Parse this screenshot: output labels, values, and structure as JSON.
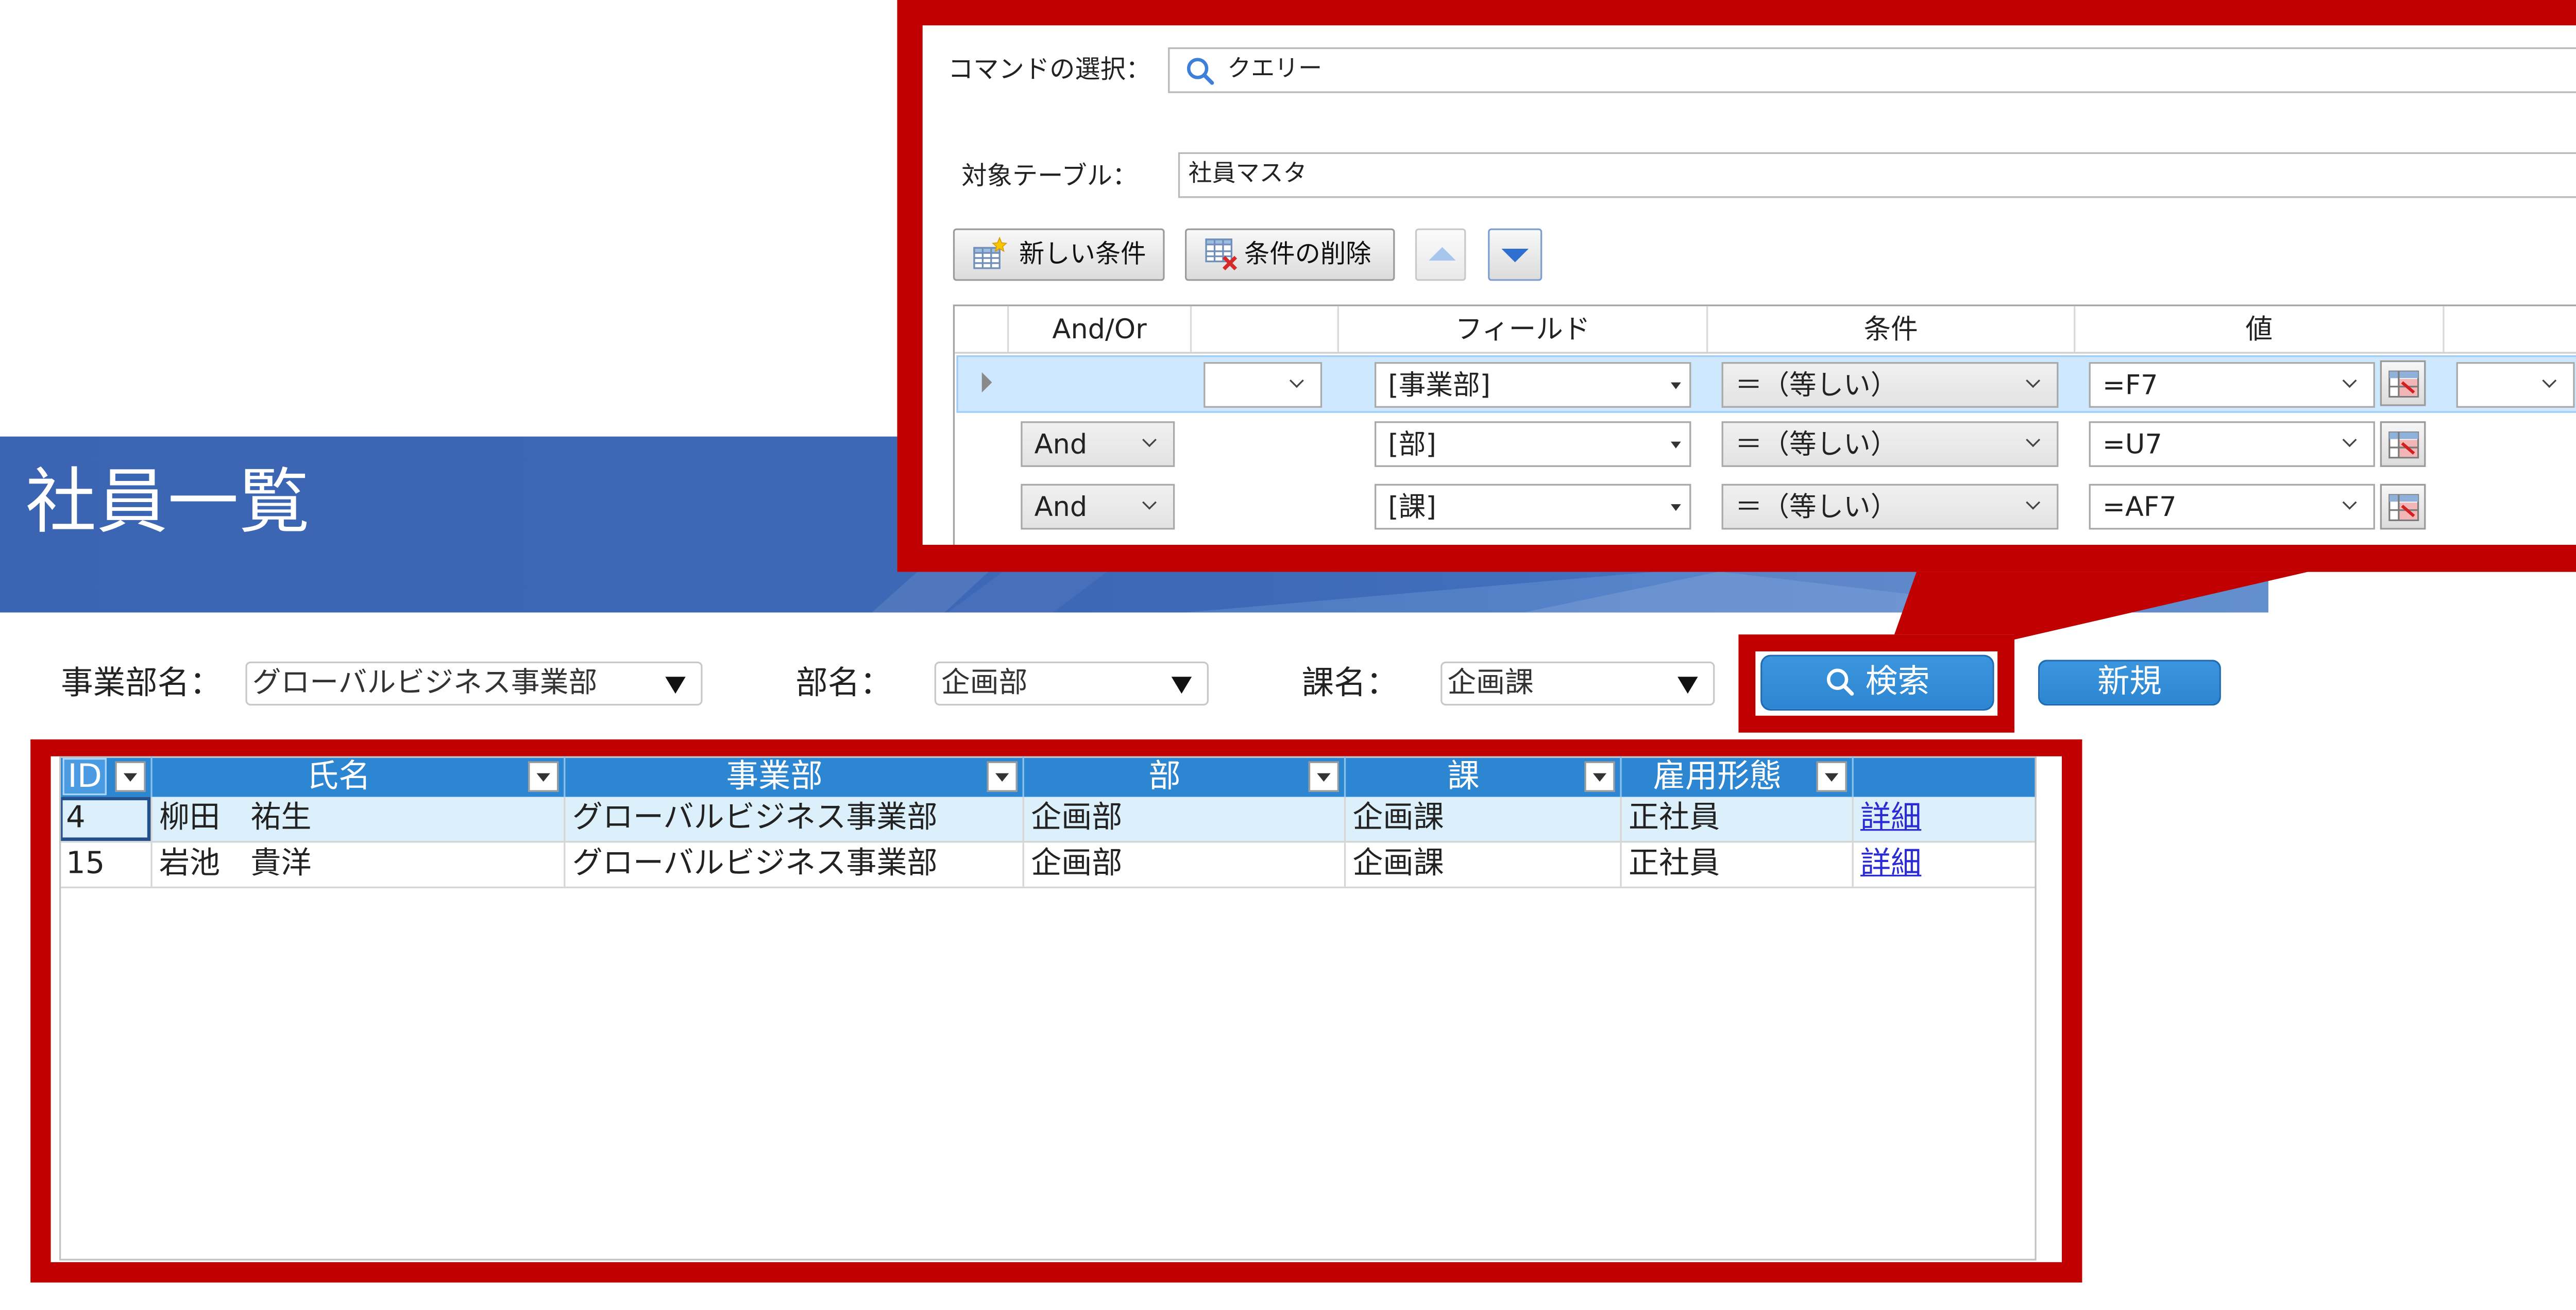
{
  "page": {
    "title": "社員一覧"
  },
  "colors": {
    "banner_blue": "#3b65b2",
    "accent_blue": "#2d86d1",
    "highlight_red": "#c00000",
    "selected_row": "#dcf0fb",
    "link_blue": "#2b2bd6"
  },
  "icons": {
    "search": "magnifier-icon",
    "dropdown": "triangle-down",
    "combo": "chevron-down",
    "new_condition": "table-star-icon",
    "delete_condition": "table-x-icon",
    "move_up": "triangle-up",
    "move_down": "triangle-down",
    "value_picker": "cell-picker-icon"
  },
  "filters": {
    "division": {
      "label": "事業部名：",
      "value": "グローバルビジネス事業部"
    },
    "department": {
      "label": "部名：",
      "value": "企画部"
    },
    "section": {
      "label": "課名：",
      "value": "企画課"
    }
  },
  "buttons": {
    "search": "検索",
    "new": "新規"
  },
  "table": {
    "columns": [
      "ID",
      "氏名",
      "事業部",
      "部",
      "課",
      "雇用形態"
    ],
    "rows": [
      {
        "id": "4",
        "name": "柳田　祐生",
        "division": "グローバルビジネス事業部",
        "department": "企画部",
        "section": "企画課",
        "employment": "正社員",
        "detail": "詳細"
      },
      {
        "id": "15",
        "name": "岩池　貴洋",
        "division": "グローバルビジネス事業部",
        "department": "企画部",
        "section": "企画課",
        "employment": "正社員",
        "detail": "詳細"
      }
    ]
  },
  "query_panel": {
    "command": {
      "label": "コマンドの選択：",
      "value": "クエリー"
    },
    "target_table": {
      "label": "対象テーブル：",
      "value": "社員マスタ"
    },
    "toolbar": {
      "new_condition": "新しい条件",
      "delete_condition": "条件の削除"
    },
    "grid_headers": {
      "and_or": "And/Or",
      "field": "フィールド",
      "condition": "条件",
      "value": "値"
    },
    "conditions": [
      {
        "and_or": "",
        "field": "[事業部]",
        "operator": "＝（等しい）",
        "value": "=F7"
      },
      {
        "and_or": "And",
        "field": "[部]",
        "operator": "＝（等しい）",
        "value": "=U7"
      },
      {
        "and_or": "And",
        "field": "[課]",
        "operator": "＝（等しい）",
        "value": "=AF7"
      }
    ]
  }
}
